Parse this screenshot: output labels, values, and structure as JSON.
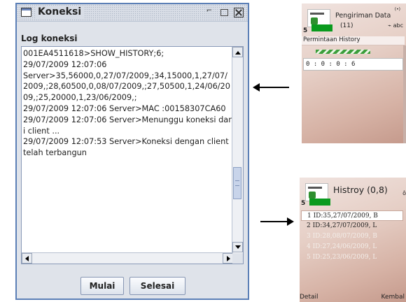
{
  "window": {
    "title": "Koneksi",
    "log_label": "Log koneksi",
    "log_text": "001EA4511618>SHOW_HISTORY;6;\n29/07/2009 12:07:06\nServer>35,56000,0,27/07/2009,;34,15000,1,27/07/2009,;28,60500,0,08/07/2009,;27,50500,1,24/06/2009,;25,20000,1,23/06/2009,;\n29/07/2009 12:07:06 Server>MAC :00158307CA60\n29/07/2009 12:07:06 Server>Menunggu koneksi dari client ...\n29/07/2009 12:07:53 Server>Koneksi dengan client telah terbangun",
    "buttons": {
      "start": "Mulai",
      "stop": "Selesai"
    }
  },
  "phone1": {
    "title": "Pengiriman Data",
    "indicator": "(11)",
    "status_icons": "abc",
    "signal_number": "5",
    "tab_label": "Permintaan History",
    "input_value": "0 : 0 : 0 : 6"
  },
  "phone2": {
    "title": "Histroy (0,8)",
    "signal_number": "5",
    "items": [
      "1 ID:35,27/07/2009, B",
      "2 ID:34,27/07/2009, L",
      "3 ID:28,08/07/2009, B",
      "4 ID:27,24/06/2009, L",
      "5 ID:25,23/06/2009, L"
    ],
    "softkey_left": "Detail",
    "softkey_right": "Kembal"
  }
}
